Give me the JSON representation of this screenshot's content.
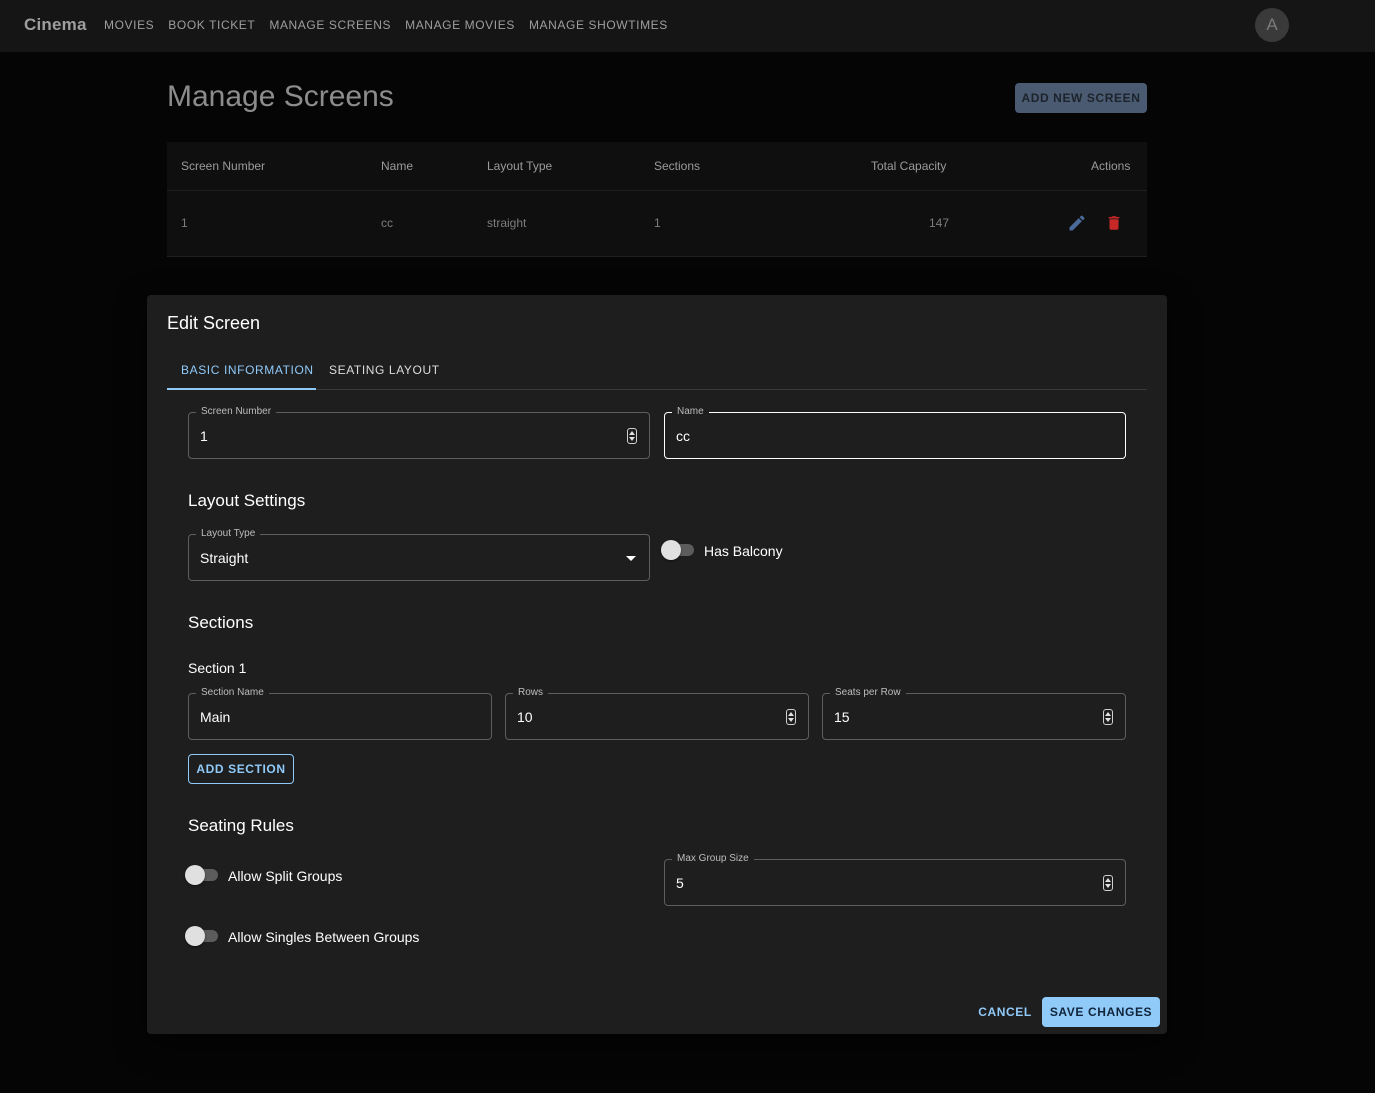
{
  "appbar": {
    "brand": "Cinema",
    "nav": [
      "MOVIES",
      "BOOK TICKET",
      "MANAGE SCREENS",
      "MANAGE MOVIES",
      "MANAGE SHOWTIMES"
    ],
    "avatar_initial": "A"
  },
  "page": {
    "title": "Manage Screens",
    "add_button": "ADD NEW SCREEN"
  },
  "table": {
    "headers": [
      "Screen Number",
      "Name",
      "Layout Type",
      "Sections",
      "Total Capacity",
      "Actions"
    ],
    "rows": [
      {
        "screen_number": "1",
        "name": "cc",
        "layout_type": "straight",
        "sections": "1",
        "total_capacity": "147"
      }
    ],
    "action_icons": [
      "edit-icon",
      "delete-icon"
    ]
  },
  "dialog": {
    "title": "Edit Screen",
    "tabs": [
      "BASIC INFORMATION",
      "SEATING LAYOUT"
    ],
    "active_tab": "BASIC INFORMATION",
    "screen_number": {
      "label": "Screen Number",
      "value": "1"
    },
    "name": {
      "label": "Name",
      "value": "cc"
    },
    "layout_settings": {
      "heading": "Layout Settings",
      "layout_type": {
        "label": "Layout Type",
        "value": "Straight"
      },
      "has_balcony": {
        "label": "Has Balcony",
        "checked": false
      }
    },
    "sections": {
      "heading": "Sections",
      "items": [
        {
          "title": "Section 1",
          "section_name": {
            "label": "Section Name",
            "value": "Main"
          },
          "rows": {
            "label": "Rows",
            "value": "10"
          },
          "seats_per_row": {
            "label": "Seats per Row",
            "value": "15"
          }
        }
      ],
      "add_button": "ADD SECTION"
    },
    "seating_rules": {
      "heading": "Seating Rules",
      "allow_split_groups": {
        "label": "Allow Split Groups",
        "checked": false
      },
      "allow_singles": {
        "label": "Allow Singles Between Groups",
        "checked": false
      },
      "max_group_size": {
        "label": "Max Group Size",
        "value": "5"
      }
    },
    "cancel_label": "CANCEL",
    "save_label": "SAVE CHANGES"
  },
  "colors": {
    "accent": "#90caf9",
    "delete": "#c62828",
    "edit": "#4a6a9a",
    "dialog_bg": "#1e1e1e"
  }
}
